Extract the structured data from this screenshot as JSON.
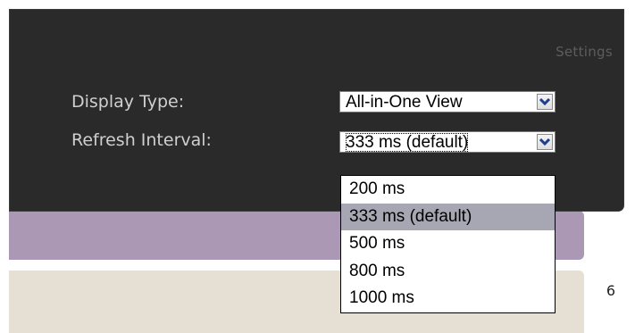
{
  "settings_panel": {
    "title": "Settings",
    "display_type": {
      "label": "Display Type:",
      "selected": "All-in-One View"
    },
    "refresh_interval": {
      "label": "Refresh Interval:",
      "selected": "333 ms (default)",
      "options": [
        "200 ms",
        "333 ms (default)",
        "500 ms",
        "800 ms",
        "1000 ms"
      ],
      "highlighted_index": 1
    }
  },
  "background": {
    "partial_glyph": "6"
  },
  "colors": {
    "panel_bg": "#2a2a2a",
    "label_text": "#cfcfcf",
    "title_text": "#5d5d5d",
    "purple_strip": "#aa98b4",
    "beige_strip": "#e6dfd4",
    "option_highlight": "#a7a7b3"
  },
  "icons": {
    "dropdown_arrow": "chevron-down-icon"
  }
}
